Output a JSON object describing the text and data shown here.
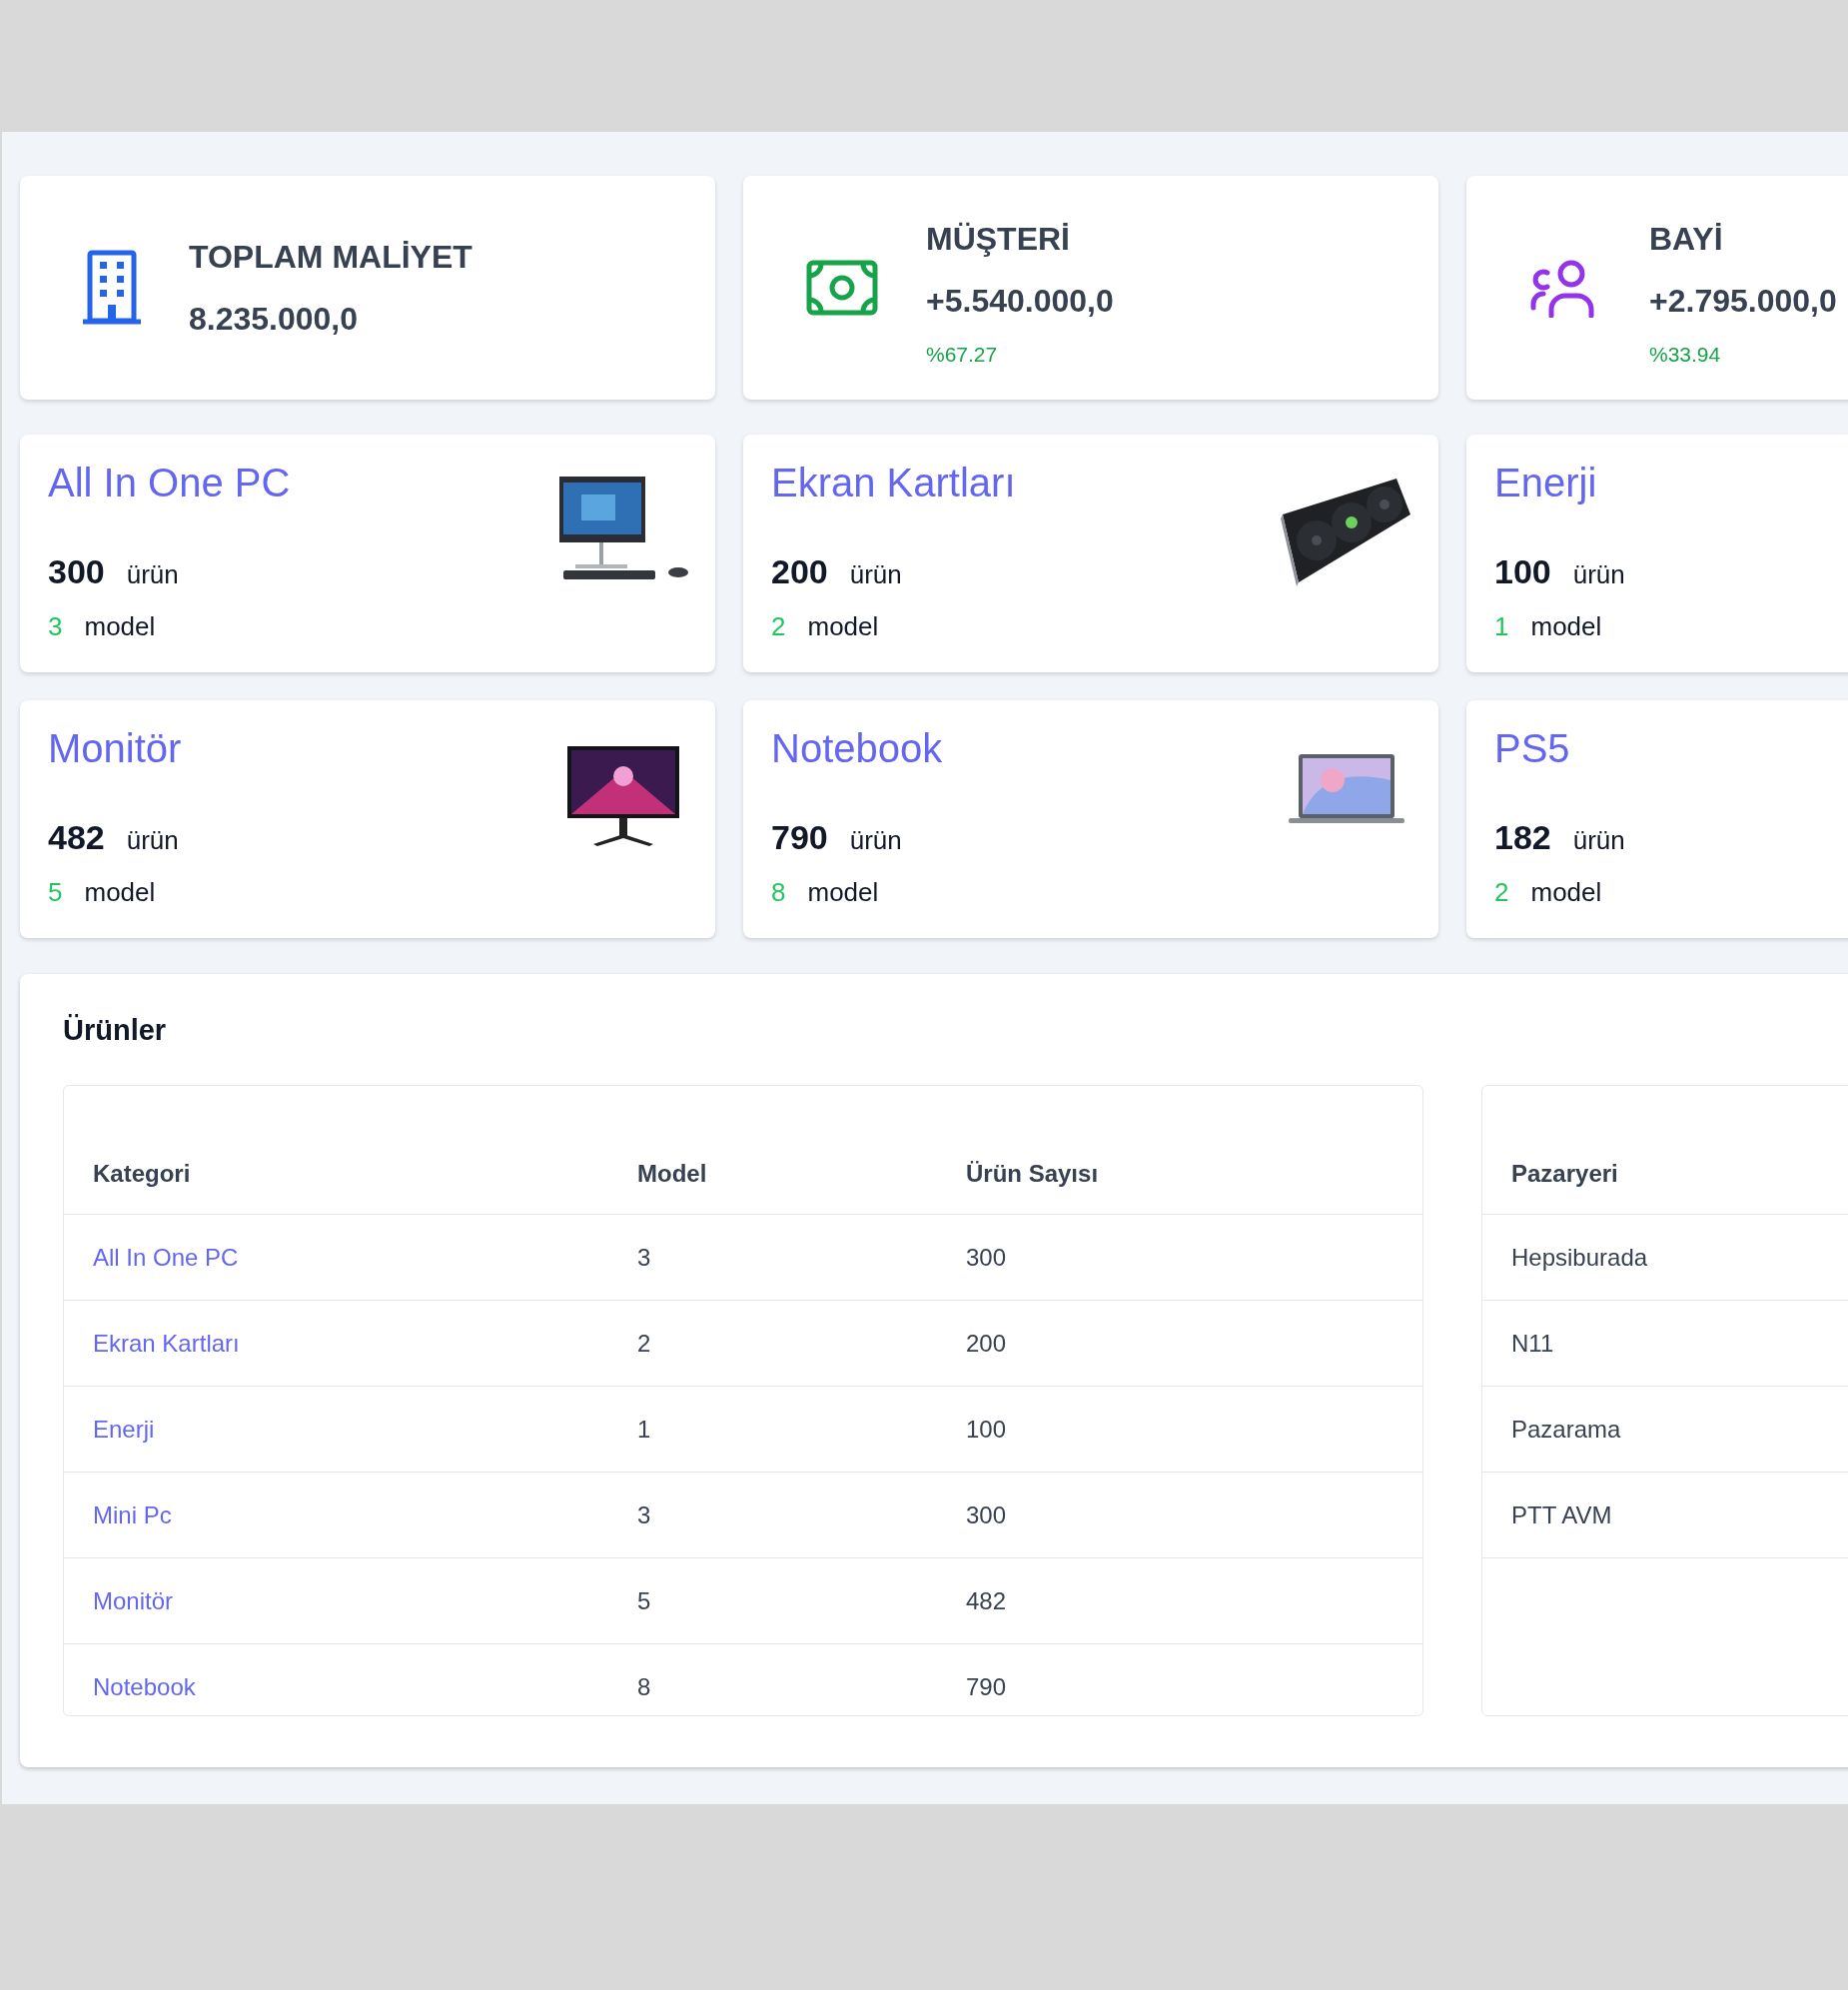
{
  "stats": [
    {
      "label": "TOPLAM MALİYET",
      "value": "8.235.000,0"
    },
    {
      "label": "MÜŞTERİ",
      "value": "+5.540.000,0",
      "change": "%67.27"
    },
    {
      "label": "BAYİ",
      "value": "+2.795.000,0",
      "change": "%33.94"
    }
  ],
  "categories": [
    {
      "title": "All In One PC",
      "count": "300",
      "count_unit": "ürün",
      "models": "3",
      "models_unit": "model",
      "picture": true
    },
    {
      "title": "Ekran Kartları",
      "count": "200",
      "count_unit": "ürün",
      "models": "2",
      "models_unit": "model",
      "picture": true
    },
    {
      "title": "Enerji",
      "count": "100",
      "count_unit": "ürün",
      "models": "1",
      "models_unit": "model"
    },
    {
      "title": "Monitör",
      "count": "482",
      "count_unit": "ürün",
      "models": "5",
      "models_unit": "model",
      "picture": true
    },
    {
      "title": "Notebook",
      "count": "790",
      "count_unit": "ürün",
      "models": "8",
      "models_unit": "model",
      "picture": true
    },
    {
      "title": "PS5",
      "count": "182",
      "count_unit": "ürün",
      "models": "2",
      "models_unit": "model"
    }
  ],
  "products": {
    "title": "Ürünler",
    "table": {
      "columns": [
        "Kategori",
        "Model",
        "Ürün Sayısı"
      ],
      "rows": [
        [
          "All In One PC",
          "3",
          "300"
        ],
        [
          "Ekran Kartları",
          "2",
          "200"
        ],
        [
          "Enerji",
          "1",
          "100"
        ],
        [
          "Mini Pc",
          "3",
          "300"
        ],
        [
          "Monitör",
          "5",
          "482"
        ],
        [
          "Notebook",
          "8",
          "790"
        ]
      ]
    },
    "marketplaces": {
      "columns": [
        "Pazaryeri"
      ],
      "rows": [
        [
          "Hepsiburada"
        ],
        [
          "N11"
        ],
        [
          "Pazarama"
        ],
        [
          "PTT AVM"
        ]
      ]
    }
  }
}
